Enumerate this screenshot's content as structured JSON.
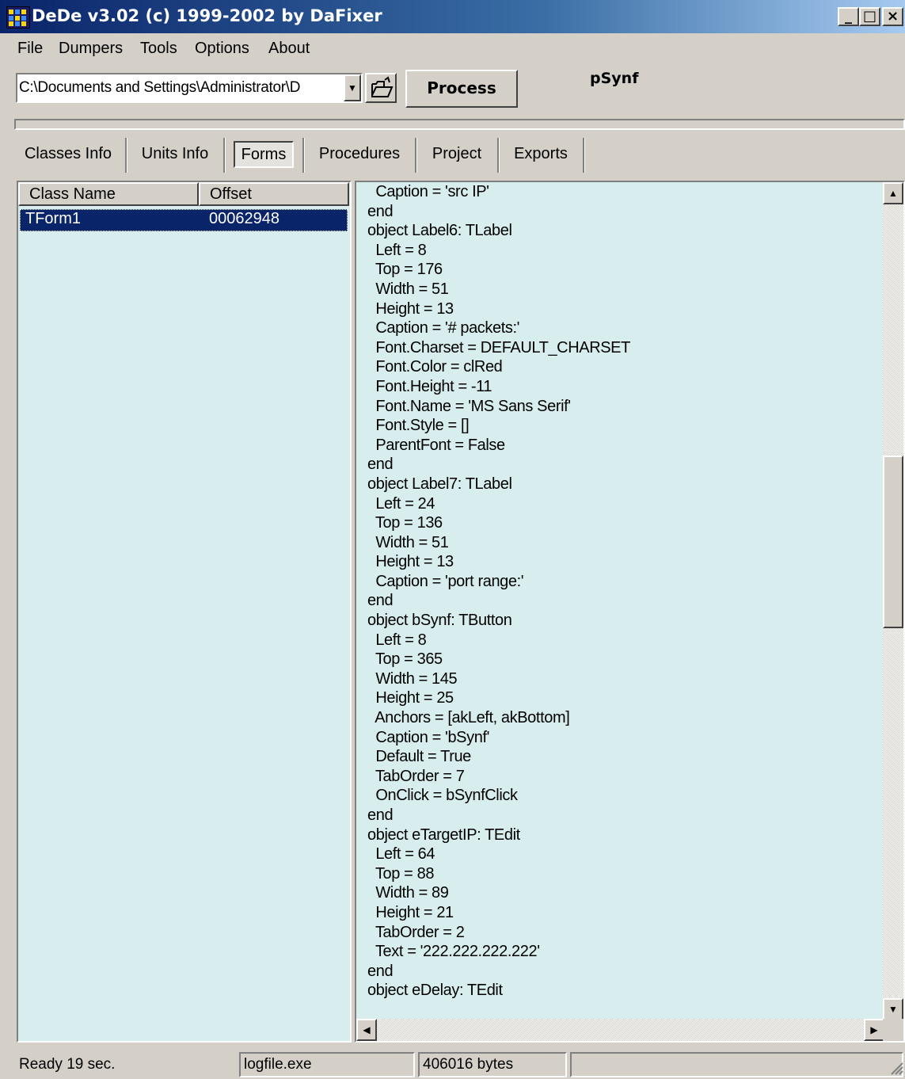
{
  "window": {
    "title": "DeDe v3.02 (c) 1999-2002 by DaFixer",
    "minimize_label": "_",
    "maximize_label": "□",
    "close_label": "×"
  },
  "menu": [
    "File",
    "Dumpers",
    "Tools",
    "Options",
    "About"
  ],
  "toolbar": {
    "path_value": "C:\\Documents and Settings\\Administrator\\D",
    "process_label": "Process",
    "project_name": "pSynf"
  },
  "tabs": [
    "Classes Info",
    "Units Info",
    "Forms",
    "Procedures",
    "Project",
    "Exports"
  ],
  "active_tab": "Forms",
  "class_list": {
    "columns": [
      "Class Name",
      "Offset"
    ],
    "rows": [
      {
        "name": "TForm1",
        "offset": "00062948"
      }
    ]
  },
  "code_lines": [
    "  Caption = 'src IP'",
    "end",
    "object Label6: TLabel",
    "  Left = 8",
    "  Top = 176",
    "  Width = 51",
    "  Height = 13",
    "  Caption = '# packets:'",
    "  Font.Charset = DEFAULT_CHARSET",
    "  Font.Color = clRed",
    "  Font.Height = -11",
    "  Font.Name = 'MS Sans Serif'",
    "  Font.Style = []",
    "  ParentFont = False",
    "end",
    "object Label7: TLabel",
    "  Left = 24",
    "  Top = 136",
    "  Width = 51",
    "  Height = 13",
    "  Caption = 'port range:'",
    "end",
    "object bSynf: TButton",
    "  Left = 8",
    "  Top = 365",
    "  Width = 145",
    "  Height = 25",
    "  Anchors = [akLeft, akBottom]",
    "  Caption = 'bSynf'",
    "  Default = True",
    "  TabOrder = 7",
    "  OnClick = bSynfClick",
    "end",
    "object eTargetIP: TEdit",
    "  Left = 64",
    "  Top = 88",
    "  Width = 89",
    "  Height = 21",
    "  TabOrder = 2",
    "  Text = '222.222.222.222'",
    "end",
    "object eDelay: TEdit"
  ],
  "status": {
    "message": "Ready 19 sec.",
    "file": "logfile.exe",
    "size": "406016 bytes"
  },
  "colors": {
    "title_bar": "#0a246a",
    "panel_bg": "#d8eeee",
    "selection": "#0a246a",
    "chrome": "#d4d0c8"
  },
  "icons": [
    "dede-app-icon",
    "open-folder-icon",
    "dropdown-arrow-icon",
    "scroll-up-icon",
    "scroll-down-icon",
    "scroll-left-icon",
    "scroll-right-icon",
    "size-grip-icon"
  ]
}
